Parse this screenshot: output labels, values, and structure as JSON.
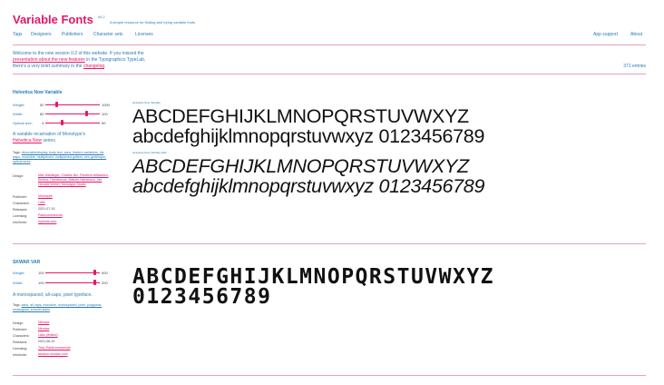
{
  "header": {
    "title": "Variable Fonts",
    "version": "v0.2",
    "tagline": "A simple resource for finding and trying variable fonts"
  },
  "nav": {
    "left": [
      "Tags",
      "Designers",
      "Publishers",
      "Character sets",
      "Licenses"
    ],
    "right": [
      "App support",
      "About"
    ]
  },
  "welcome": {
    "line1": "Welcome to the new version 0.2 of this website. If you missed the",
    "link1": "presentation about the new features",
    "line2": " in the Typographics TypeLab,",
    "line3": "there's a very brief summary in the ",
    "link2": "changelog",
    "line3_end": "."
  },
  "entries_count": "371 entries",
  "fonts": [
    {
      "name": "Helvetica Now Variable",
      "axes": [
        {
          "label": "Weight:",
          "min": "50",
          "max": "1000",
          "value_fraction": 0.2
        },
        {
          "label": "Width:",
          "min": "80",
          "max": "100",
          "value_fraction": 0.75
        },
        {
          "label": "Optical size:",
          "min": "4",
          "max": "50",
          "value_fraction": 0.3
        }
      ],
      "description_pre": "A variable incarnation of Monotype's",
      "description_link": "Helvetica Now",
      "description_post": " series.",
      "tags_label": "Tags:",
      "tags": "decorative/display, body text, sans, feature variations, ink traps, monoline, multiplexed, multiplexed gutters, neo-grotesque, optical sizes",
      "meta": [
        {
          "label": "Design:",
          "value": "Max Miedinger, Charles Nix, Friedrich Althausen, Emilios Theofanous, Makoto Nishimura, Jan Hendrik Weber, Monotype Studio"
        },
        {
          "label": "Publisher:",
          "value": "Monotype"
        },
        {
          "label": "Characters:",
          "value": "Latin"
        },
        {
          "label": "Released:",
          "value": "2021-07-15"
        },
        {
          "label": "Licensing:",
          "value": "Paid/commercial"
        },
        {
          "label": "Info/fonts:",
          "value": "myfonts.com"
        }
      ],
      "samples": [
        {
          "label": "Helvetica Now Variable",
          "text": "ABCDEFGHIJKLMNOPQRSTUVWXYZ abcdefghijklmnopqrstuvwxyz 0123456789"
        },
        {
          "label": "Helvetica Now Variable Italic",
          "text": "ABCDEFGHIJKLMNOPQRSTUVWXYZ abcdefghijklmnopqrstuvwxyz 0123456789"
        }
      ]
    },
    {
      "name": "SKWAR VAR",
      "axes": [
        {
          "label": "Weight:",
          "min": "100",
          "max": "900",
          "value_fraction": 0.9
        },
        {
          "label": "Width:",
          "min": "100",
          "max": "200",
          "value_fraction": 0.9
        }
      ],
      "description": "A monospaced, all-caps, pixel typeface.",
      "tags_label": "Tags:",
      "tags": "sans, all caps, monoline, monospaced, pixel, polygonal, rectangular, smooth sides",
      "meta": [
        {
          "label": "Design:",
          "value": "Néodaz"
        },
        {
          "label": "Publisher:",
          "value": "Néodaz"
        },
        {
          "label": "Characters:",
          "value": "Latin (limited)"
        },
        {
          "label": "Released:",
          "value": "2021-06-19"
        },
        {
          "label": "Licensing:",
          "value": "Trial, Paid/commercial"
        },
        {
          "label": "Info/fonts:",
          "value": "fandom.neodaz.com"
        }
      ],
      "sample": "ABCDEFGHIJKLMNOPQRSTUVWXYZ 0123456789"
    }
  ]
}
